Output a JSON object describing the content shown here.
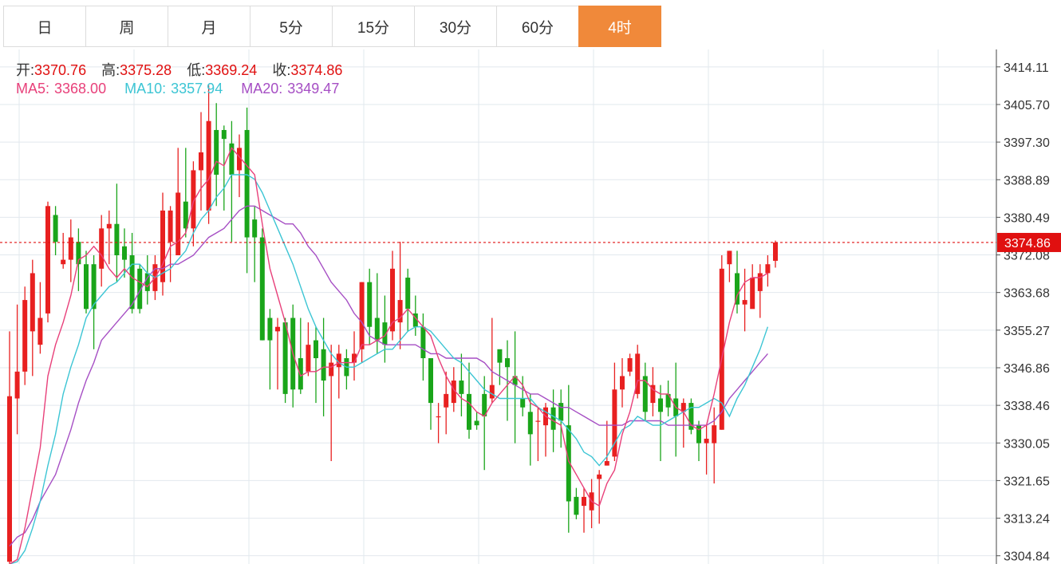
{
  "tabs": [
    {
      "label": "日",
      "active": false
    },
    {
      "label": "周",
      "active": false
    },
    {
      "label": "月",
      "active": false
    },
    {
      "label": "5分",
      "active": false
    },
    {
      "label": "15分",
      "active": false
    },
    {
      "label": "30分",
      "active": false
    },
    {
      "label": "60分",
      "active": false
    },
    {
      "label": "4时",
      "active": true
    }
  ],
  "ohlc": {
    "open_label": "开:",
    "open": "3370.76",
    "high_label": "高:",
    "high": "3375.28",
    "low_label": "低:",
    "low": "3369.24",
    "close_label": "收:",
    "close": "3374.86"
  },
  "ma": {
    "ma5_label": "MA5:",
    "ma5": "3368.00",
    "ma10_label": "MA10:",
    "ma10": "3357.94",
    "ma20_label": "MA20:",
    "ma20": "3349.47"
  },
  "colors": {
    "up": "#e82020",
    "down": "#1aa51a",
    "ma5": "#e8407a",
    "ma10": "#3cc5d4",
    "ma20": "#a64fc4",
    "active_tab": "#f0893a",
    "grid": "#e2e8ee",
    "price_line": "#e01010"
  },
  "chart_data": {
    "type": "candlestick",
    "y_ticks": [
      "3414.11",
      "3405.70",
      "3397.30",
      "3388.89",
      "3380.49",
      "3372.08",
      "3363.68",
      "3355.27",
      "3346.86",
      "3338.46",
      "3330.05",
      "3321.65",
      "3313.24",
      "3304.84"
    ],
    "ylim": [
      3303,
      3418
    ],
    "current_price": 3374.86,
    "current_price_label": "3374.86",
    "candles": [
      [
        3303.5,
        3340.5,
        3300,
        3355
      ],
      [
        3340,
        3346,
        3332,
        3361
      ],
      [
        3346,
        3362,
        3343,
        3365
      ],
      [
        3355,
        3368,
        3345,
        3371
      ],
      [
        3352,
        3358,
        3350,
        3366
      ],
      [
        3359,
        3383,
        3357,
        3384
      ],
      [
        3381,
        3375,
        3372,
        3383
      ],
      [
        3370,
        3371,
        3369,
        3377
      ],
      [
        3371,
        3376,
        3366,
        3380
      ],
      [
        3375,
        3370,
        3364,
        3378
      ],
      [
        3370,
        3360,
        3359,
        3373
      ],
      [
        3370,
        3360,
        3351,
        3372
      ],
      [
        3369,
        3378,
        3365,
        3381
      ],
      [
        3378,
        3379,
        3370,
        3382
      ],
      [
        3379,
        3372,
        3366,
        3388
      ],
      [
        3374,
        3371,
        3367,
        3378
      ],
      [
        3372,
        3360,
        3359,
        3377
      ],
      [
        3369,
        3360,
        3359,
        3370
      ],
      [
        3368,
        3364,
        3361,
        3372
      ],
      [
        3364,
        3370,
        3362,
        3372
      ],
      [
        3366,
        3382,
        3363,
        3386
      ],
      [
        3375,
        3382,
        3366,
        3383
      ],
      [
        3372,
        3386,
        3372,
        3396
      ],
      [
        3384,
        3378,
        3376,
        3396
      ],
      [
        3378,
        3391,
        3374,
        3393
      ],
      [
        3391,
        3395,
        3382,
        3404
      ],
      [
        3382,
        3402,
        3379,
        3410
      ],
      [
        3400,
        3390,
        3383,
        3406
      ],
      [
        3400,
        3398,
        3382,
        3401
      ],
      [
        3397,
        3390,
        3375,
        3402
      ],
      [
        3391,
        3396,
        3385,
        3399
      ],
      [
        3400,
        3376,
        3368,
        3405
      ],
      [
        3380,
        3376,
        3366,
        3383
      ],
      [
        3376,
        3353,
        3353,
        3378
      ],
      [
        3358,
        3353,
        3342,
        3360
      ],
      [
        3355,
        3356,
        3342,
        3358
      ],
      [
        3357,
        3341,
        3339,
        3358
      ],
      [
        3358,
        3342,
        3338,
        3361
      ],
      [
        3349,
        3342,
        3341,
        3358
      ],
      [
        3346,
        3352,
        3345,
        3357
      ],
      [
        3353,
        3349,
        3339,
        3356
      ],
      [
        3351,
        3344,
        3336,
        3358
      ],
      [
        3345,
        3348,
        3326,
        3352
      ],
      [
        3347,
        3350,
        3340,
        3352
      ],
      [
        3349,
        3345,
        3342,
        3351
      ],
      [
        3348,
        3350,
        3344,
        3355
      ],
      [
        3351,
        3366,
        3348,
        3366
      ],
      [
        3366,
        3356,
        3352,
        3369
      ],
      [
        3358,
        3353,
        3350,
        3368
      ],
      [
        3357,
        3352,
        3348,
        3363
      ],
      [
        3355,
        3369,
        3353,
        3373
      ],
      [
        3357,
        3362,
        3351,
        3375
      ],
      [
        3367,
        3360,
        3355,
        3369
      ],
      [
        3359,
        3356,
        3354,
        3363
      ],
      [
        3356,
        3349,
        3344,
        3359
      ],
      [
        3349,
        3339,
        3333,
        3346
      ],
      [
        3336,
        3336,
        3330,
        3339
      ],
      [
        3338,
        3341,
        3332,
        3346
      ],
      [
        3339,
        3344,
        3337,
        3347
      ],
      [
        3344,
        3341,
        3336,
        3350
      ],
      [
        3341,
        3333,
        3331,
        3348
      ],
      [
        3335,
        3334,
        3333,
        3337
      ],
      [
        3341,
        3336,
        3324,
        3345
      ],
      [
        3340,
        3343,
        3339,
        3358
      ],
      [
        3351,
        3348,
        3343,
        3350
      ],
      [
        3349,
        3347,
        3335,
        3353
      ],
      [
        3345,
        3343,
        3330,
        3355
      ],
      [
        3340,
        3338,
        3336,
        3345
      ],
      [
        3337,
        3332,
        3325,
        3341
      ],
      [
        3335,
        3335,
        3326,
        3338
      ],
      [
        3334,
        3338,
        3327,
        3339
      ],
      [
        3338,
        3333,
        3328,
        3342
      ],
      [
        3339,
        3335,
        3329,
        3342
      ],
      [
        3334,
        3317,
        3310,
        3343
      ],
      [
        3318,
        3314,
        3313,
        3320
      ],
      [
        3316,
        3318,
        3310,
        3320
      ],
      [
        3315,
        3319,
        3311,
        3322
      ],
      [
        3322,
        3323,
        3312,
        3324
      ],
      [
        3325,
        3326,
        3325,
        3335
      ],
      [
        3327,
        3342,
        3326,
        3348
      ],
      [
        3342,
        3345,
        3338,
        3349
      ],
      [
        3346,
        3349,
        3345,
        3350
      ],
      [
        3341,
        3350,
        3340,
        3352
      ],
      [
        3345,
        3337,
        3335,
        3348
      ],
      [
        3339,
        3343,
        3336,
        3347
      ],
      [
        3340,
        3337,
        3326,
        3343
      ],
      [
        3341,
        3338,
        3336,
        3344
      ],
      [
        3340,
        3336,
        3327,
        3348
      ],
      [
        3337,
        3339,
        3329,
        3340
      ],
      [
        3339,
        3333,
        3332,
        3340
      ],
      [
        3334,
        3330,
        3326,
        3335
      ],
      [
        3330,
        3331,
        3323,
        3334
      ],
      [
        3330,
        3334,
        3321,
        3338
      ],
      [
        3333,
        3369,
        3333,
        3372
      ],
      [
        3370,
        3373,
        3366,
        3373
      ],
      [
        3368,
        3361,
        3359,
        3373
      ],
      [
        3361,
        3362,
        3355,
        3369
      ],
      [
        3360,
        3367,
        3361,
        3370
      ],
      [
        3364,
        3368,
        3358,
        3370
      ],
      [
        3368,
        3370,
        3365,
        3372
      ],
      [
        3370.76,
        3374.86,
        3369.24,
        3375.28
      ]
    ],
    "ma5": [
      3303,
      3304,
      3311,
      3320,
      3329,
      3345,
      3352,
      3357,
      3363,
      3371,
      3372,
      3374,
      3372,
      3369,
      3367,
      3369,
      3367,
      3366,
      3365,
      3367,
      3370,
      3374,
      3375,
      3377,
      3384,
      3387,
      3389,
      3393,
      3392,
      3396,
      3394,
      3392,
      3390,
      3379,
      3369,
      3363,
      3357,
      3350,
      3345,
      3346,
      3346,
      3347,
      3347,
      3348,
      3348,
      3348,
      3352,
      3352,
      3353,
      3354,
      3357,
      3358,
      3360,
      3358,
      3356,
      3354,
      3349,
      3345,
      3342,
      3340,
      3339,
      3337,
      3336,
      3339,
      3341,
      3343,
      3345,
      3343,
      3339,
      3338,
      3336,
      3335,
      3334,
      3326,
      3323,
      3320,
      3317,
      3316,
      3321,
      3324,
      3332,
      3337,
      3344,
      3344,
      3342,
      3341,
      3341,
      3338,
      3337,
      3334,
      3333,
      3334,
      3341,
      3349,
      3357,
      3363,
      3366,
      3367,
      3367,
      3368
    ],
    "ma10": [
      3303,
      3303.5,
      3306,
      3311,
      3317,
      3325,
      3332,
      3341,
      3347,
      3352,
      3358,
      3361,
      3363,
      3365,
      3366,
      3368,
      3370,
      3370,
      3368,
      3367,
      3368,
      3369,
      3371,
      3373,
      3377,
      3380,
      3382,
      3385,
      3387,
      3390,
      3390,
      3390,
      3389,
      3386,
      3382,
      3378,
      3374,
      3370,
      3365,
      3360,
      3356,
      3353,
      3350,
      3348,
      3347,
      3347,
      3348,
      3349,
      3350,
      3351,
      3351,
      3353,
      3355,
      3356,
      3356,
      3355,
      3353,
      3351,
      3349,
      3348,
      3346,
      3344,
      3342,
      3341,
      3340,
      3340,
      3340,
      3340,
      3340,
      3338,
      3337,
      3336,
      3335,
      3333,
      3331,
      3328,
      3327,
      3325,
      3327,
      3330,
      3333,
      3334,
      3336,
      3335,
      3334,
      3334,
      3335,
      3336,
      3337,
      3338,
      3338,
      3339,
      3340,
      3339,
      3336,
      3340,
      3343,
      3347,
      3351,
      3356
    ],
    "ma20": [
      3307,
      3309,
      3310,
      3313,
      3317,
      3320,
      3323,
      3328,
      3333,
      3339,
      3344,
      3348,
      3353,
      3355,
      3357,
      3359,
      3361,
      3364,
      3367,
      3369,
      3369,
      3370,
      3370,
      3371,
      3372,
      3374,
      3376,
      3377,
      3378,
      3380,
      3382,
      3383,
      3383,
      3382,
      3381,
      3380,
      3379,
      3379,
      3377,
      3374,
      3372,
      3369,
      3366,
      3364,
      3362,
      3359,
      3357,
      3354,
      3353,
      3352,
      3352,
      3352,
      3352,
      3352,
      3351,
      3350,
      3350,
      3349,
      3349,
      3349,
      3349,
      3349,
      3348,
      3346,
      3345,
      3344,
      3343,
      3342,
      3341,
      3341,
      3340,
      3339,
      3338,
      3338,
      3337,
      3336,
      3335,
      3334,
      3334,
      3334,
      3334,
      3335,
      3335,
      3335,
      3335,
      3335,
      3334,
      3334,
      3334,
      3334,
      3334,
      3334,
      3335,
      3337,
      3340,
      3342,
      3344,
      3346,
      3348,
      3350
    ]
  }
}
